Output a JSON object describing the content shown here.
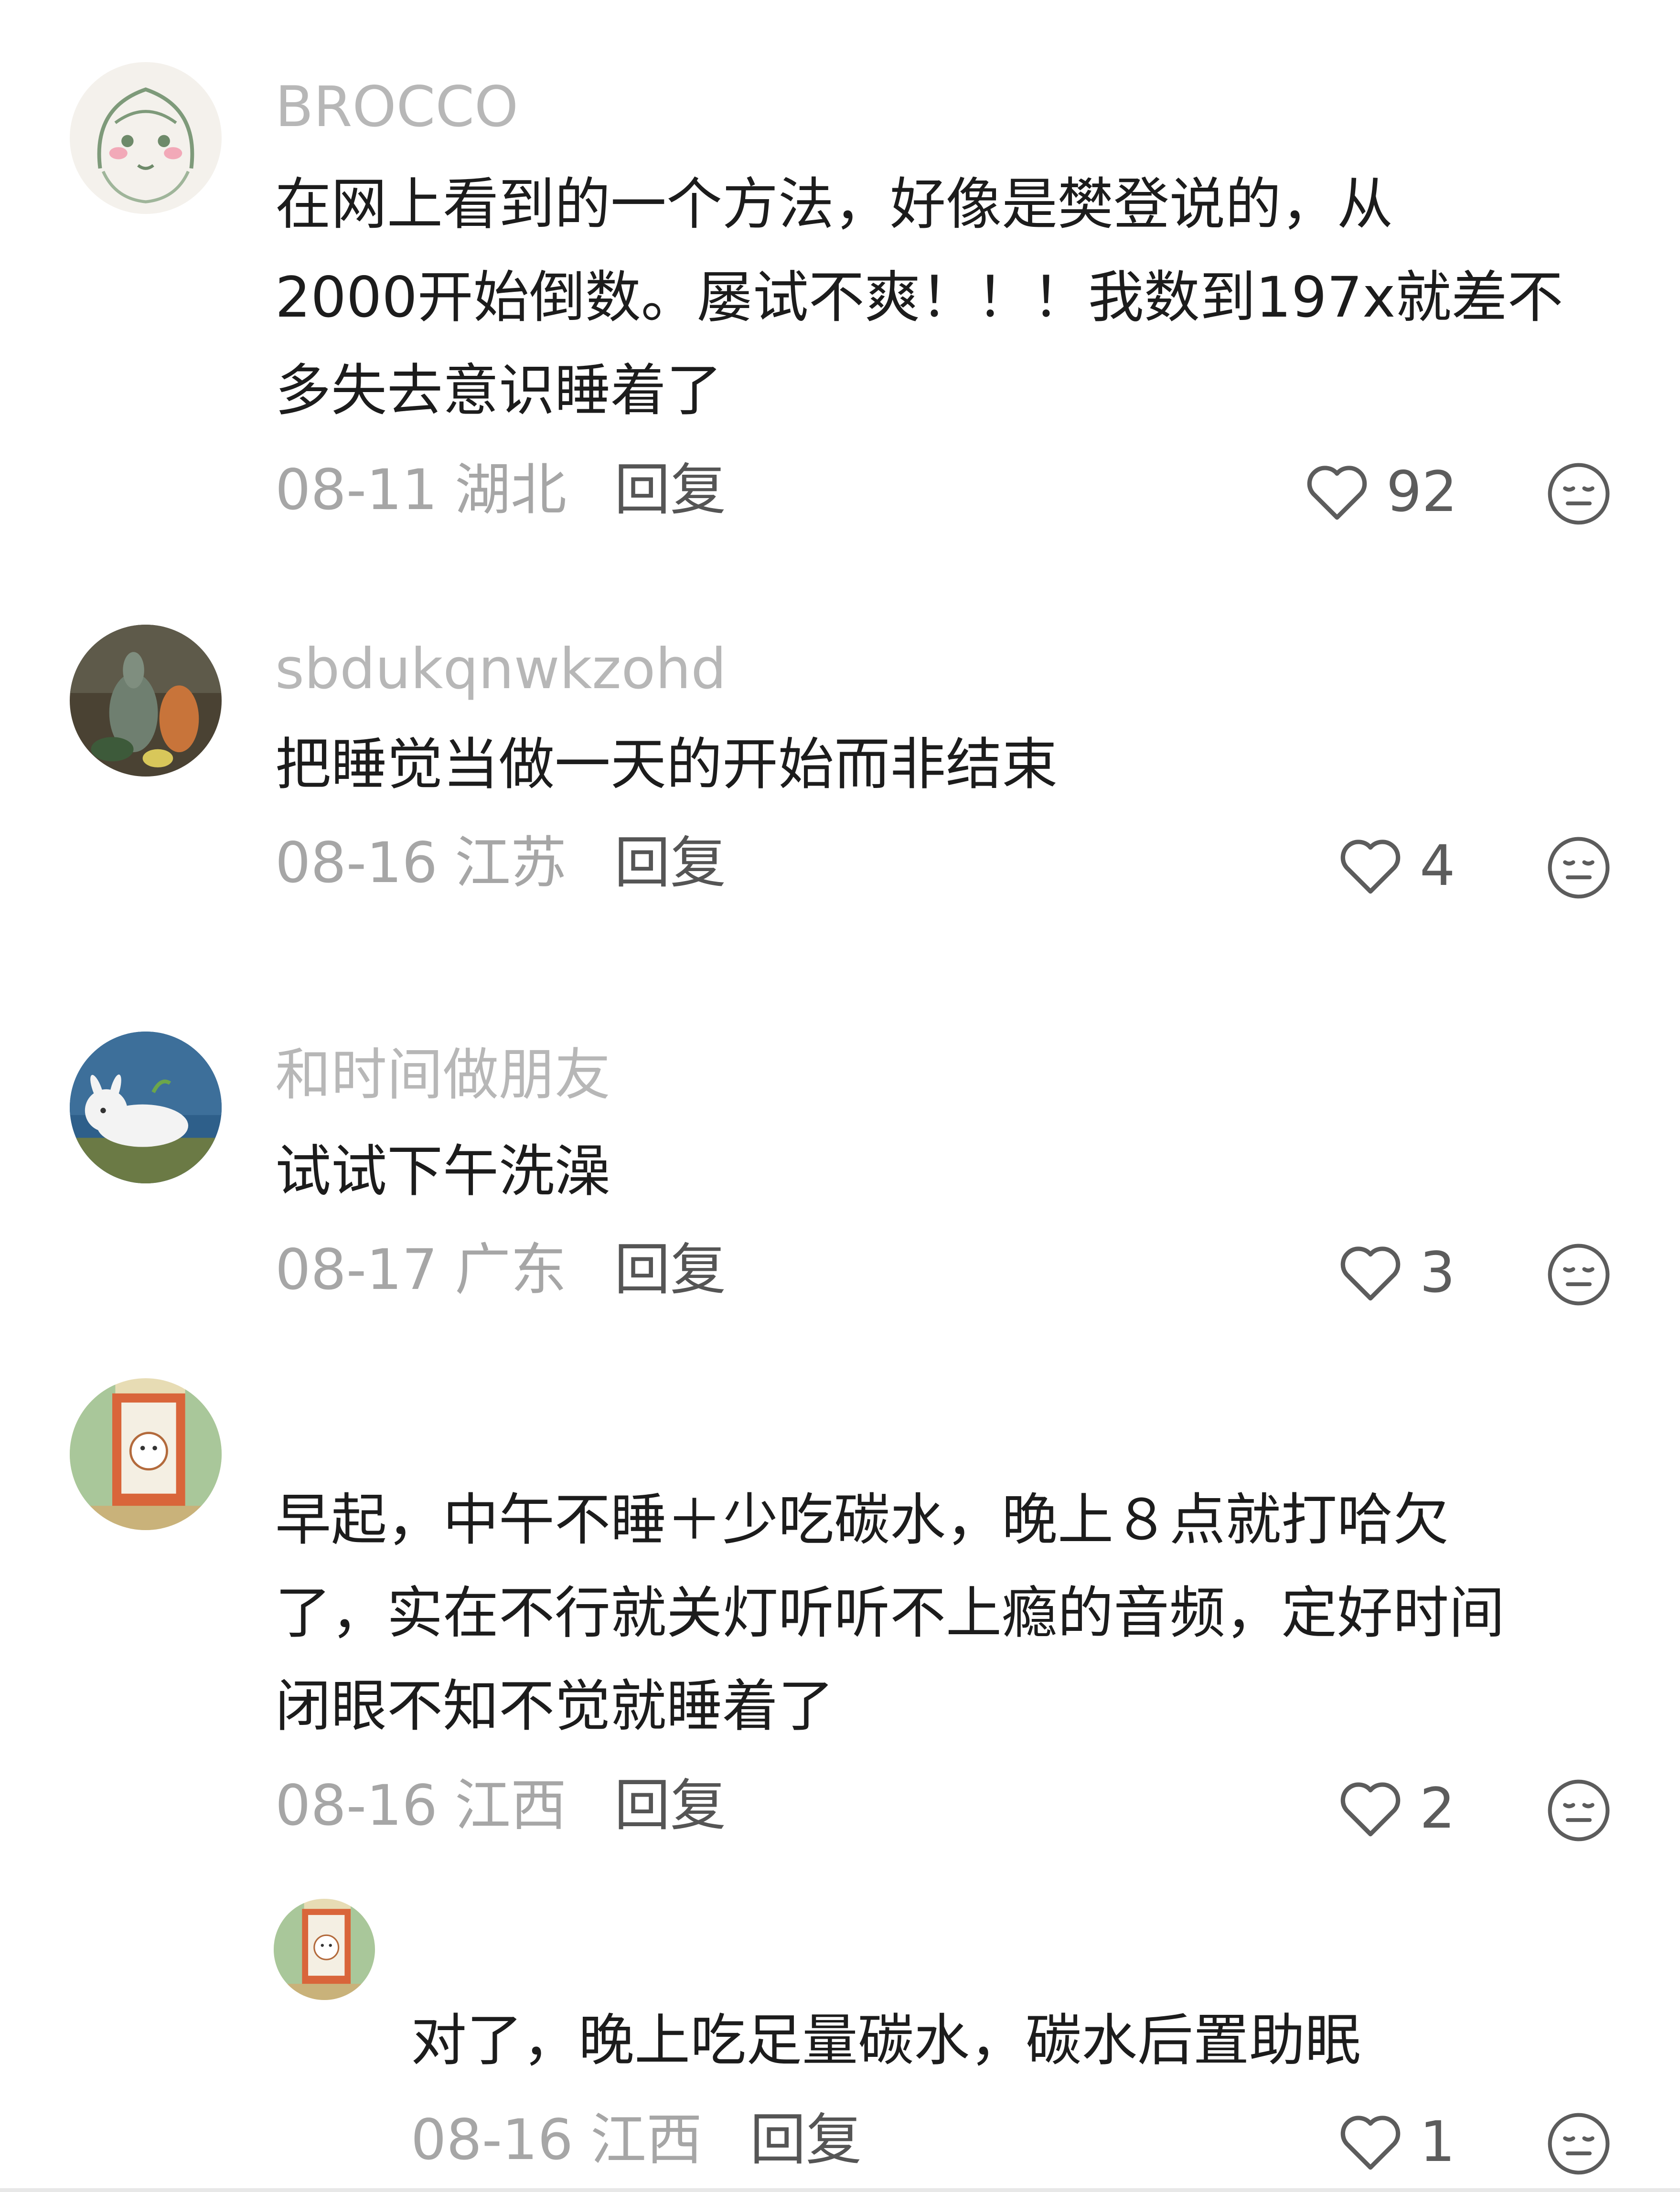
{
  "colors": {
    "text": "#1c1c1c",
    "muted": "#a6a6a6",
    "username": "#b7b7b7",
    "reply": "#555555",
    "icon": "#5c5c5c"
  },
  "comments": [
    {
      "username": "BROCCO",
      "lines": [
        "在网上看到的一个方法，好像是樊登说的，从",
        "2000开始倒数。屡试不爽！！！我数到197x就差不",
        "多失去意识睡着了"
      ],
      "date": "08-11",
      "region": "湖北",
      "reply": "回复",
      "likes": "92",
      "avatar": "anime-girl-avatar"
    },
    {
      "username": "sbdukqnwkzohd",
      "lines": [
        "把睡觉当做一天的开始而非结束"
      ],
      "date": "08-16",
      "region": "江苏",
      "reply": "回复",
      "likes": "4",
      "avatar": "gourds-avatar"
    },
    {
      "username": "和时间做朋友",
      "lines": [
        "试试下午洗澡"
      ],
      "date": "08-17",
      "region": "广东",
      "reply": "回复",
      "likes": "3",
      "avatar": "rabbit-lying-avatar"
    },
    {
      "username": "",
      "lines": [
        "早起，中午不睡＋少吃碳水，晚上８点就打哈欠",
        "了，实在不行就关灯听听不上瘾的音频，定好时间",
        "闭眼不知不觉就睡着了"
      ],
      "date": "08-16",
      "region": "江西",
      "reply": "回复",
      "likes": "2",
      "avatar": "dog-door-avatar"
    },
    {
      "username": "",
      "lines": [
        "对了，晚上吃足量碳水，碳水后置助眠"
      ],
      "date": "08-16",
      "region": "江西",
      "reply": "回复",
      "likes": "1",
      "avatar": "dog-door-avatar"
    }
  ]
}
